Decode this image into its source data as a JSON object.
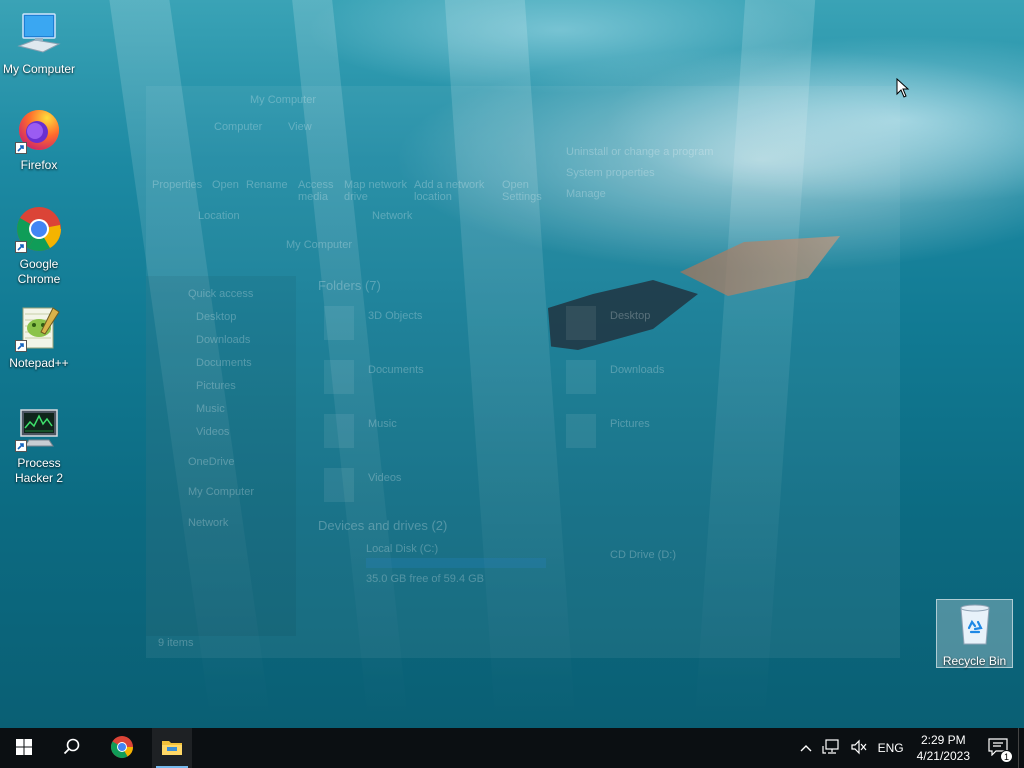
{
  "desktop": {
    "icons": [
      {
        "label": "My Computer",
        "icon": "computer-icon"
      },
      {
        "label": "Firefox",
        "icon": "firefox-icon"
      },
      {
        "label": "Google Chrome",
        "icon": "chrome-icon"
      },
      {
        "label": "Notepad++",
        "icon": "notepadpp-icon"
      },
      {
        "label": "Process Hacker 2",
        "icon": "process-hacker-icon"
      },
      {
        "label": "Recycle Bin",
        "icon": "recycle-bin-icon"
      }
    ]
  },
  "ghost_window": {
    "title": "My Computer",
    "tabs": [
      "Computer",
      "View"
    ],
    "ribbon": [
      "Properties",
      "Open",
      "Rename",
      "Access media",
      "Map network drive",
      "Add a network location",
      "Open Settings"
    ],
    "ribbon_side": [
      "Uninstall or change a program",
      "System properties",
      "Manage"
    ],
    "groups": [
      "Location",
      "Network"
    ],
    "address": "My Computer",
    "nav": [
      "Quick access",
      "Desktop",
      "Downloads",
      "Documents",
      "Pictures",
      "Music",
      "Videos",
      "OneDrive",
      "My Computer",
      "Network"
    ],
    "folders_header": "Folders (7)",
    "folders": [
      "3D Objects",
      "Desktop",
      "Documents",
      "Downloads",
      "Music",
      "Pictures",
      "Videos"
    ],
    "devices_header": "Devices and drives (2)",
    "drive_c": "Local Disk (C:)",
    "drive_c_space": "35.0 GB free of 59.4 GB",
    "drive_d": "CD Drive (D:)",
    "status": "9 items"
  },
  "taskbar": {
    "start_icon": "windows-start-icon",
    "search_icon": "search-icon",
    "pinned": [
      {
        "name": "chrome",
        "icon": "chrome-icon"
      },
      {
        "name": "file-explorer",
        "icon": "folder-icon",
        "active": true
      }
    ],
    "tray": {
      "language": "ENG",
      "time": "2:29 PM",
      "date": "4/21/2023",
      "notification_count": "1"
    }
  },
  "colors": {
    "taskbar": "#0b0f12",
    "accent": "#76b9ed"
  }
}
